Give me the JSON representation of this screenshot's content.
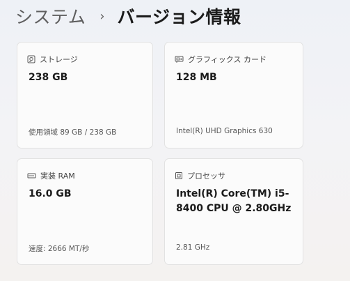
{
  "breadcrumb": {
    "parent": "システム",
    "separator": "›",
    "current": "バージョン情報"
  },
  "cards": {
    "storage": {
      "title": "ストレージ",
      "icon": "hard-drive-icon",
      "value": "238 GB",
      "detail": "使用領域 89 GB / 238 GB"
    },
    "graphics": {
      "title": "グラフィックス カード",
      "icon": "display-adapter-icon",
      "value": "128 MB",
      "detail": "Intel(R) UHD Graphics 630"
    },
    "ram": {
      "title": "実装 RAM",
      "icon": "memory-icon",
      "value": "16.0 GB",
      "detail": "速度: 2666 MT/秒"
    },
    "processor": {
      "title": "プロセッサ",
      "icon": "processor-icon",
      "value": "Intel(R) Core(TM) i5-8400 CPU @ 2.80GHz",
      "detail": "2.81 GHz"
    }
  }
}
